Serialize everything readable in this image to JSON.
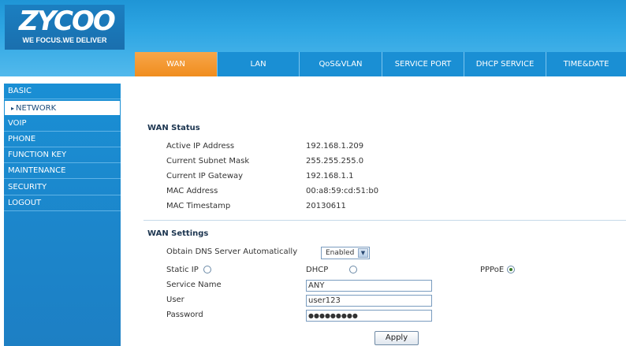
{
  "logo": {
    "brand": "ZYCOO",
    "tagline": "WE FOCUS.WE DELIVER"
  },
  "tabs": [
    {
      "label": "WAN",
      "active": true
    },
    {
      "label": "LAN"
    },
    {
      "label": "QoS&VLAN"
    },
    {
      "label": "SERVICE PORT"
    },
    {
      "label": "DHCP SERVICE"
    },
    {
      "label": "TIME&DATE"
    }
  ],
  "sidebar": {
    "items": [
      {
        "label": "BASIC"
      },
      {
        "label": "NETWORK",
        "active": true
      },
      {
        "label": "VOIP"
      },
      {
        "label": "PHONE"
      },
      {
        "label": "FUNCTION KEY"
      },
      {
        "label": "MAINTENANCE"
      },
      {
        "label": "SECURITY"
      },
      {
        "label": "LOGOUT"
      }
    ]
  },
  "wan_status": {
    "title": "WAN Status",
    "rows": [
      {
        "label": "Active IP Address",
        "value": "192.168.1.209"
      },
      {
        "label": "Current Subnet Mask",
        "value": "255.255.255.0"
      },
      {
        "label": "Current IP Gateway",
        "value": "192.168.1.1"
      },
      {
        "label": "MAC Address",
        "value": "00:a8:59:cd:51:b0"
      },
      {
        "label": "MAC Timestamp",
        "value": "20130611"
      }
    ]
  },
  "wan_settings": {
    "title": "WAN Settings",
    "dns_label": "Obtain DNS Server Automatically",
    "dns_value": "Enabled",
    "static_ip_label": "Static IP",
    "dhcp_label": "DHCP",
    "pppoe_label": "PPPoE",
    "selected_mode": "PPPoE",
    "service_name_label": "Service Name",
    "service_name_value": "ANY",
    "user_label": "User",
    "user_value": "user123",
    "password_label": "Password",
    "password_value": "●●●●●●●●●",
    "apply_label": "Apply"
  },
  "colors": {
    "header_blue": "#2ea6e3",
    "tab_active_orange": "#f08d1e",
    "sidebar_blue": "#1a8fd4"
  }
}
